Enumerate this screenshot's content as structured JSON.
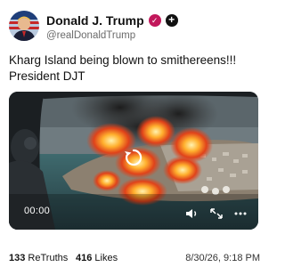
{
  "author": {
    "display_name": "Donald J. Trump",
    "handle": "@realDonaldTrump",
    "verified_badge_icon": "verified-badge-icon",
    "follow_icon": "plus-icon"
  },
  "post": {
    "lines": [
      "Kharg Island being blown to smithereens!!!",
      "President DJT"
    ]
  },
  "video": {
    "time": "00:00",
    "controls": [
      "replay-icon",
      "volume-icon",
      "fullscreen-icon",
      "more-icon"
    ]
  },
  "stats": {
    "retruths_count": "133",
    "retruths_label": "ReTruths",
    "likes_count": "416",
    "likes_label": "Likes",
    "timestamp": "8/30/26, 9:18 PM"
  },
  "colors": {
    "badge": "#c2185b",
    "text": "#111111",
    "muted": "#6b6b6b"
  }
}
